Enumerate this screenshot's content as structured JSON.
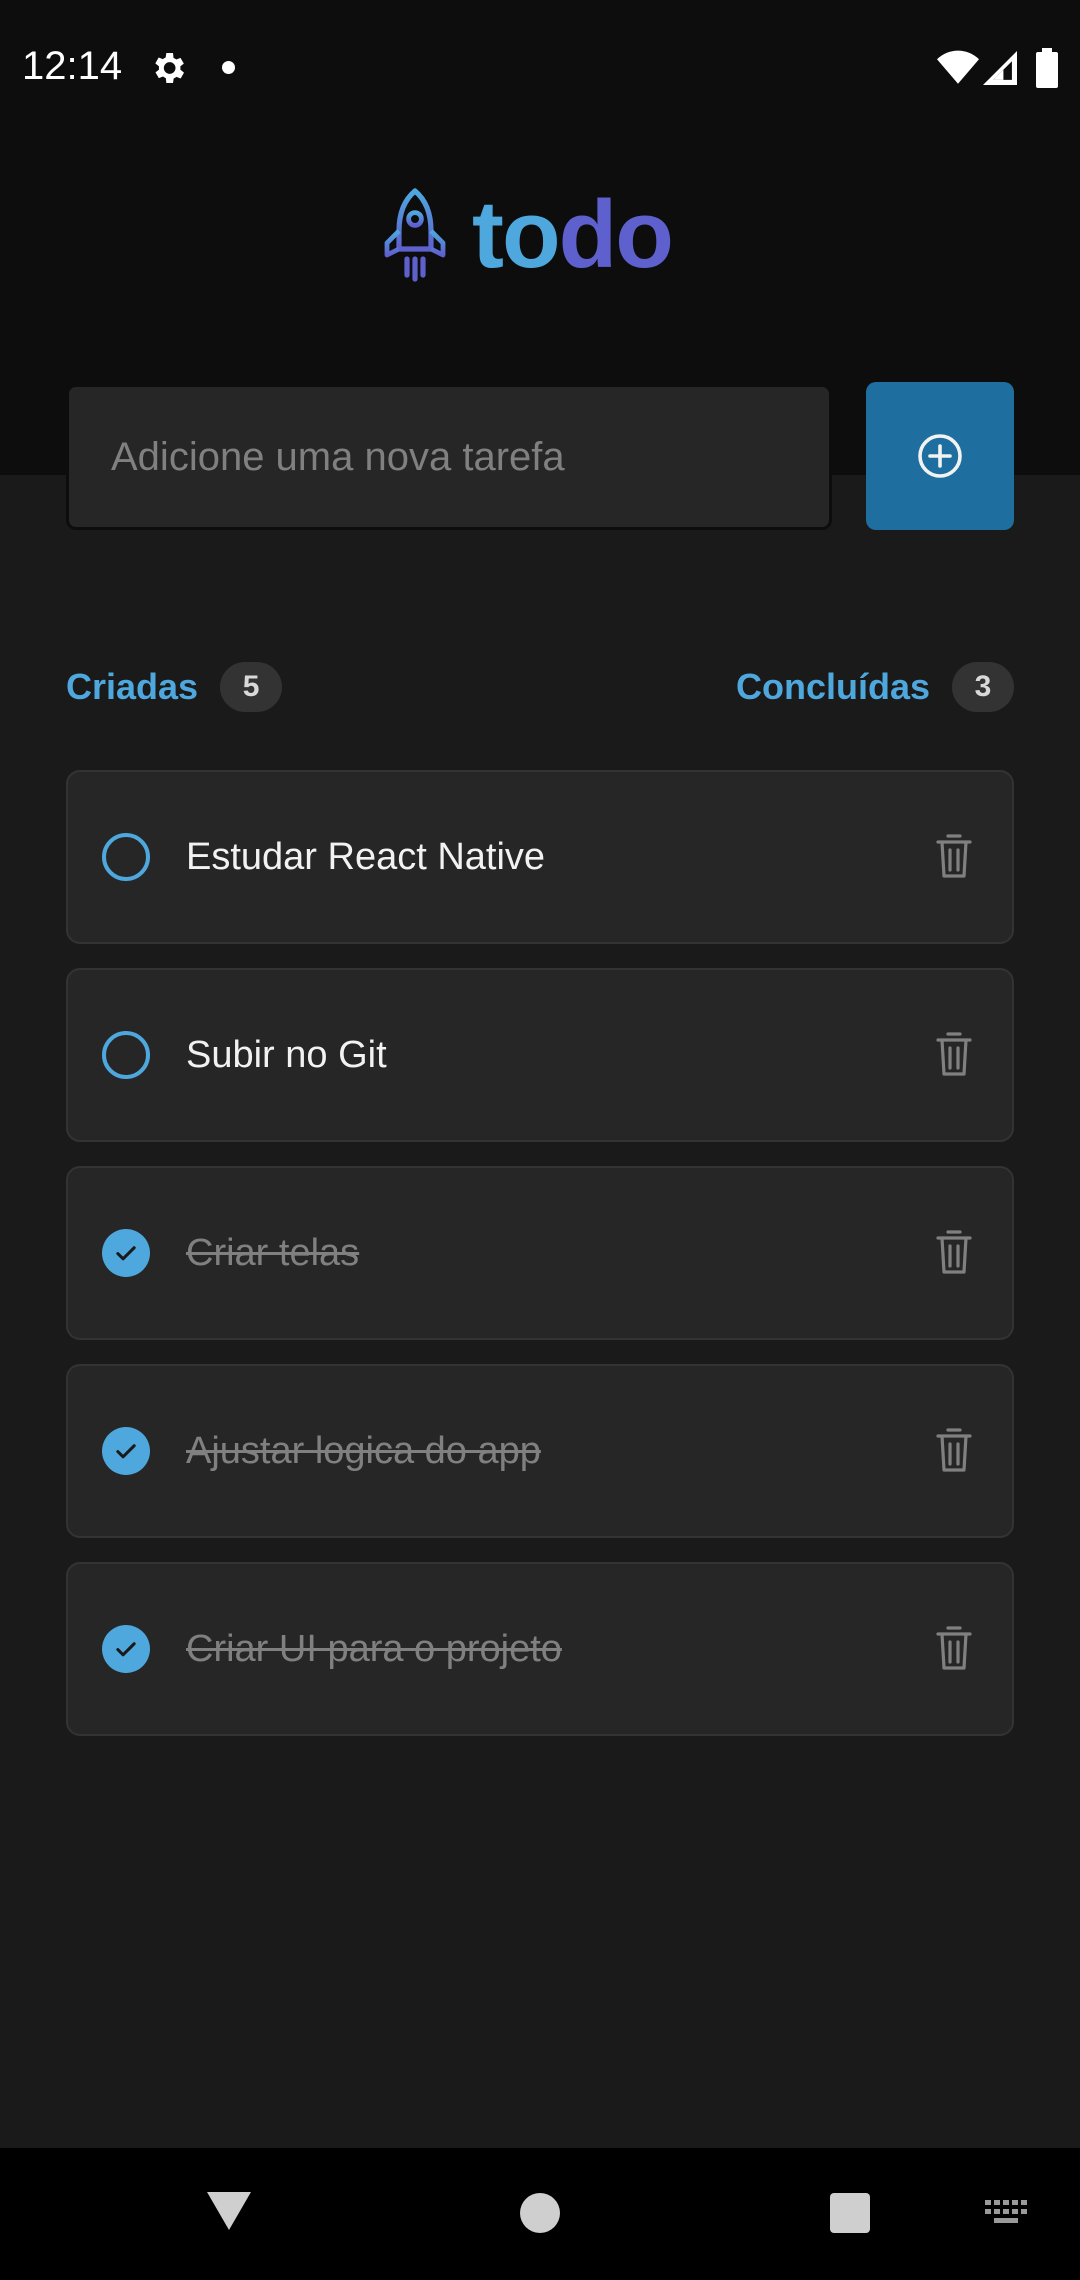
{
  "status_bar": {
    "time": "12:14",
    "icons": [
      "gear-icon",
      "notification-dot-icon",
      "wifi-icon",
      "signal-icon",
      "battery-icon"
    ]
  },
  "header": {
    "logo_part1": "to",
    "logo_part2": "do",
    "logo_icon": "rocket-icon"
  },
  "new_task": {
    "placeholder": "Adicione uma nova tarefa",
    "value": "",
    "add_icon": "plus-circle-icon"
  },
  "counters": {
    "created_label": "Criadas",
    "created_count": "5",
    "done_label": "Concluídas",
    "done_count": "3"
  },
  "tasks": [
    {
      "text": "Estudar React Native",
      "done": false
    },
    {
      "text": "Subir no Git",
      "done": false
    },
    {
      "text": "Criar telas",
      "done": true
    },
    {
      "text": "Ajustar logica do app",
      "done": true
    },
    {
      "text": "Criar UI para o projeto",
      "done": true
    }
  ],
  "nav_bar": {
    "icons": [
      "back-icon",
      "home-icon",
      "recents-icon",
      "keyboard-icon"
    ]
  },
  "colors": {
    "accent_blue": "#4ea8de",
    "accent_purple": "#5e60ce",
    "button_blue": "#1e6f9f",
    "background": "#1a1a1a",
    "header_background": "#0d0d0d",
    "card": "#262626"
  }
}
